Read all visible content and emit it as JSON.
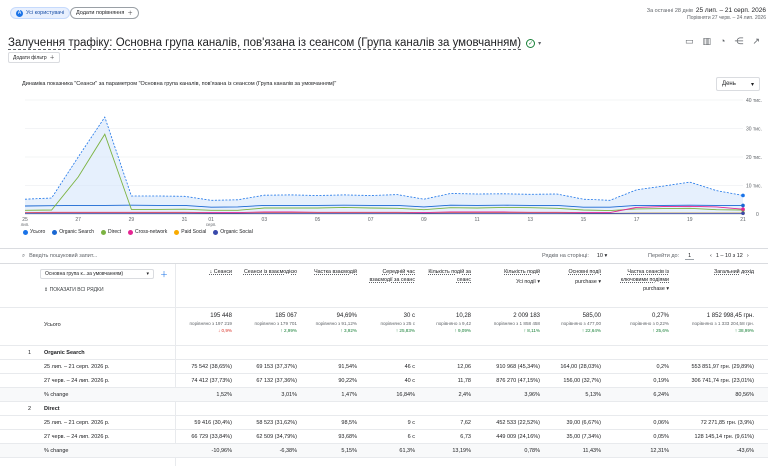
{
  "topbar": {
    "segment_label": "Усі користувачі",
    "compare_label": "Додати порівняння",
    "range_prefix": "За останні 28 днів",
    "range": "25 лип. – 21 серп. 2026",
    "compare_range": "Порівняти 27 черв. – 24 лип. 2026"
  },
  "report": {
    "title": "Залучення трафіку: Основна група каналів, пов'язана із сеансом (Група каналів за умовчанням)",
    "add_filter": "Додати фільтр"
  },
  "chart_data": {
    "type": "line",
    "title": "Динаміка показника \"Сеанси\" за параметром \"Основна група каналів, пов'язана із сеансом (Група каналів за умовчанням)\"",
    "granularity": "День",
    "x": [
      "25 лип.",
      "26",
      "27",
      "28",
      "29",
      "30",
      "31",
      "01 серп.",
      "02",
      "03",
      "04",
      "05",
      "06",
      "07",
      "08",
      "09",
      "10",
      "11",
      "12",
      "13",
      "14",
      "15",
      "16",
      "17",
      "18",
      "19",
      "20",
      "21"
    ],
    "x_tick_labels": [
      "25 лип.",
      "27",
      "29",
      "31",
      "01 серп.",
      "03",
      "05",
      "07",
      "09",
      "11",
      "13",
      "15",
      "17",
      "19",
      "21"
    ],
    "ylim": [
      0,
      40000
    ],
    "y_ticks": [
      "0",
      "10 тис.",
      "20 тис.",
      "30 тис.",
      "40 тис."
    ],
    "series": [
      {
        "name": "Усього",
        "color": "#1a73e8",
        "values": [
          5200,
          5600,
          20000,
          34000,
          6300,
          6300,
          6200,
          4800,
          5000,
          6600,
          6700,
          6500,
          6700,
          6500,
          6800,
          5200,
          7200,
          7000,
          7100,
          6900,
          7000,
          5200,
          4800,
          8500,
          9800,
          11200,
          8200,
          6500
        ]
      },
      {
        "name": "Organic Search",
        "color": "#1967d2",
        "values": [
          2800,
          2900,
          3000,
          3000,
          3100,
          3000,
          3000,
          2400,
          2500,
          3000,
          3000,
          3000,
          3100,
          3000,
          3000,
          2500,
          3100,
          3000,
          3100,
          3000,
          3000,
          2400,
          2400,
          3000,
          3000,
          3100,
          3000,
          3000
        ]
      },
      {
        "name": "Direct",
        "color": "#7cb342",
        "values": [
          1300,
          1400,
          13000,
          28000,
          1600,
          1600,
          1700,
          1300,
          1300,
          2100,
          2100,
          2100,
          2300,
          2100,
          2000,
          1500,
          2200,
          2100,
          2300,
          2200,
          2000,
          1400,
          1200,
          1800,
          1900,
          2000,
          1500,
          1400
        ]
      },
      {
        "name": "Cross-network",
        "color": "#e52592",
        "values": [
          500,
          600,
          600,
          600,
          600,
          600,
          600,
          500,
          500,
          700,
          700,
          600,
          600,
          600,
          600,
          500,
          700,
          700,
          700,
          600,
          600,
          500,
          500,
          2300,
          2600,
          2700,
          2500,
          1700
        ]
      },
      {
        "name": "Paid Social",
        "color": "#f9ab00",
        "values": [
          300,
          300,
          300,
          300,
          300,
          300,
          300,
          200,
          200,
          300,
          300,
          300,
          300,
          300,
          300,
          200,
          300,
          300,
          300,
          300,
          300,
          200,
          200,
          300,
          300,
          300,
          300,
          300
        ]
      },
      {
        "name": "Organic Social",
        "color": "#3949ab",
        "values": [
          250,
          250,
          250,
          250,
          250,
          250,
          250,
          200,
          200,
          250,
          250,
          250,
          250,
          250,
          250,
          200,
          250,
          250,
          250,
          250,
          250,
          200,
          200,
          250,
          250,
          250,
          250,
          250
        ]
      }
    ]
  },
  "table": {
    "search_placeholder": "Введіть пошуковий запит...",
    "rows_per_page_label": "Рядків на сторінці:",
    "rows_per_page": "10",
    "goto_label": "Перейти до:",
    "goto_value": "1",
    "pagination": "1 – 10 з 12",
    "dimension_select": "Основна група к...за умовчанням)",
    "show_rows": "ПОКАЗАТИ ВСІ РЯДКИ",
    "headers": [
      {
        "label": "Сеанси",
        "sub": ""
      },
      {
        "label": "Сеанси із взаємодією",
        "sub": ""
      },
      {
        "label": "Частка взаємодій",
        "sub": ""
      },
      {
        "label": "Середній час взаємодії за сеанс",
        "sub": ""
      },
      {
        "label": "Кількість подій за сеанс",
        "sub": ""
      },
      {
        "label": "Кількість подій",
        "sub": "Усі події"
      },
      {
        "label": "Основні події",
        "sub": "purchase"
      },
      {
        "label": "Частка сеансів із ключовими подіями",
        "sub": "purchase"
      },
      {
        "label": "Загальний дохід",
        "sub": ""
      }
    ],
    "totals": {
      "label": "Усього",
      "values": [
        "195 448",
        "185 067",
        "94,69%",
        "30 с",
        "10,28",
        "2 009 183",
        "585,00",
        "0,27%",
        "1 852 998,45 грн."
      ],
      "compare": [
        "порівняно з 197 219",
        "порівняно з 179 701",
        "порівняно з 91,12%",
        "порівняно з 25 с",
        "порівняно з 9,42",
        "порівняно з 1 858 458",
        "порівняно з 477,00",
        "порівняно з 0,22%",
        "порівняно з 1 333 204,58 грн."
      ],
      "changes": [
        "↓ 0,9%",
        "↑ 2,99%",
        "↑ 3,92%",
        "↑ 25,83%",
        "↑ 9,09%",
        "↑ 8,11%",
        "↑ 22,64%",
        "↑ 25,6%",
        "↑ 38,99%"
      ],
      "change_dirs": [
        "down",
        "up",
        "up",
        "up",
        "up",
        "up",
        "up",
        "up",
        "up"
      ]
    },
    "groups": [
      {
        "index": "1",
        "name": "Organic Search",
        "rows": [
          {
            "label": "25 лип. – 21 серп. 2026 р.",
            "values": [
              "75 542 (38,65%)",
              "69 153 (37,37%)",
              "91,54%",
              "46 с",
              "12,06",
              "910 968 (45,34%)",
              "164,00 (28,03%)",
              "0,2%",
              "553 851,97 грн. (29,89%)"
            ]
          },
          {
            "label": "27 черв. – 24 лип. 2026 р.",
            "values": [
              "74 412 (37,73%)",
              "67 132 (37,36%)",
              "90,22%",
              "40 с",
              "11,78",
              "876 270 (47,15%)",
              "156,00 (32,7%)",
              "0,19%",
              "306 741,74 грн. (23,01%)"
            ]
          },
          {
            "label": "% change",
            "values": [
              "1,52%",
              "3,01%",
              "1,47%",
              "16,84%",
              "2,4%",
              "3,96%",
              "5,13%",
              "6,24%",
              "80,56%"
            ]
          }
        ]
      },
      {
        "index": "2",
        "name": "Direct",
        "rows": [
          {
            "label": "25 лип. – 21 серп. 2026 р.",
            "values": [
              "59 416 (30,4%)",
              "58 523 (31,62%)",
              "98,5%",
              "9 с",
              "7,62",
              "452 533 (22,52%)",
              "39,00 (6,67%)",
              "0,06%",
              "72 271,85 грн. (3,9%)"
            ]
          },
          {
            "label": "27 черв. – 24 лип. 2026 р.",
            "values": [
              "66 729 (33,84%)",
              "62 509 (34,79%)",
              "93,68%",
              "6 с",
              "6,73",
              "449 009 (24,16%)",
              "35,00 (7,34%)",
              "0,05%",
              "128 145,14 грн. (9,61%)"
            ]
          },
          {
            "label": "% change",
            "values": [
              "-10,96%",
              "-6,38%",
              "5,15%",
              "61,3%",
              "13,19%",
              "0,78%",
              "11,43%",
              "12,31%",
              "-43,6%"
            ]
          }
        ]
      }
    ]
  }
}
